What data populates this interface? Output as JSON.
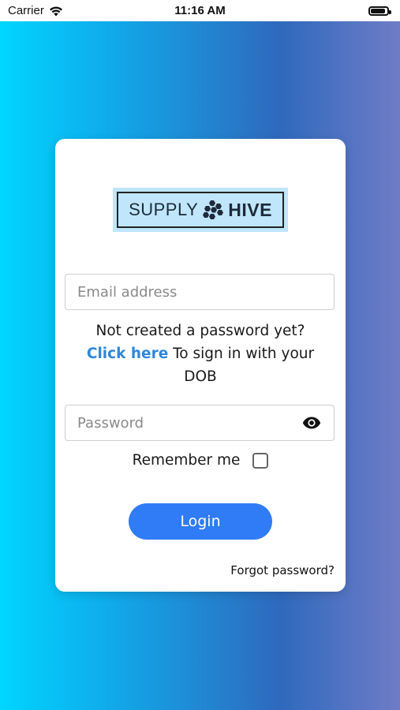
{
  "status_bar": {
    "carrier": "Carrier",
    "time": "11:16 AM",
    "battery_level": 0.9
  },
  "logo": {
    "word_supply": "SUPPLY",
    "word_hive": "HIVE",
    "icon": "honeycomb-icon",
    "background_color": "#bfe6fb"
  },
  "login": {
    "email_placeholder": "Email address",
    "email_value": "",
    "info_line1": "Not created a password yet?",
    "click_here": "Click here",
    "info_rest_1": "To sign in with your",
    "info_rest_2": "DOB",
    "password_placeholder": "Password",
    "password_value": "",
    "remember_label": "Remember me",
    "remember_checked": false,
    "login_label": "Login",
    "forgot_label": "Forgot password?"
  },
  "colors": {
    "accent": "#2f7cf6",
    "link": "#2f86d9",
    "gradient_start": "#00d6ff",
    "gradient_end": "#6f7cc6"
  }
}
